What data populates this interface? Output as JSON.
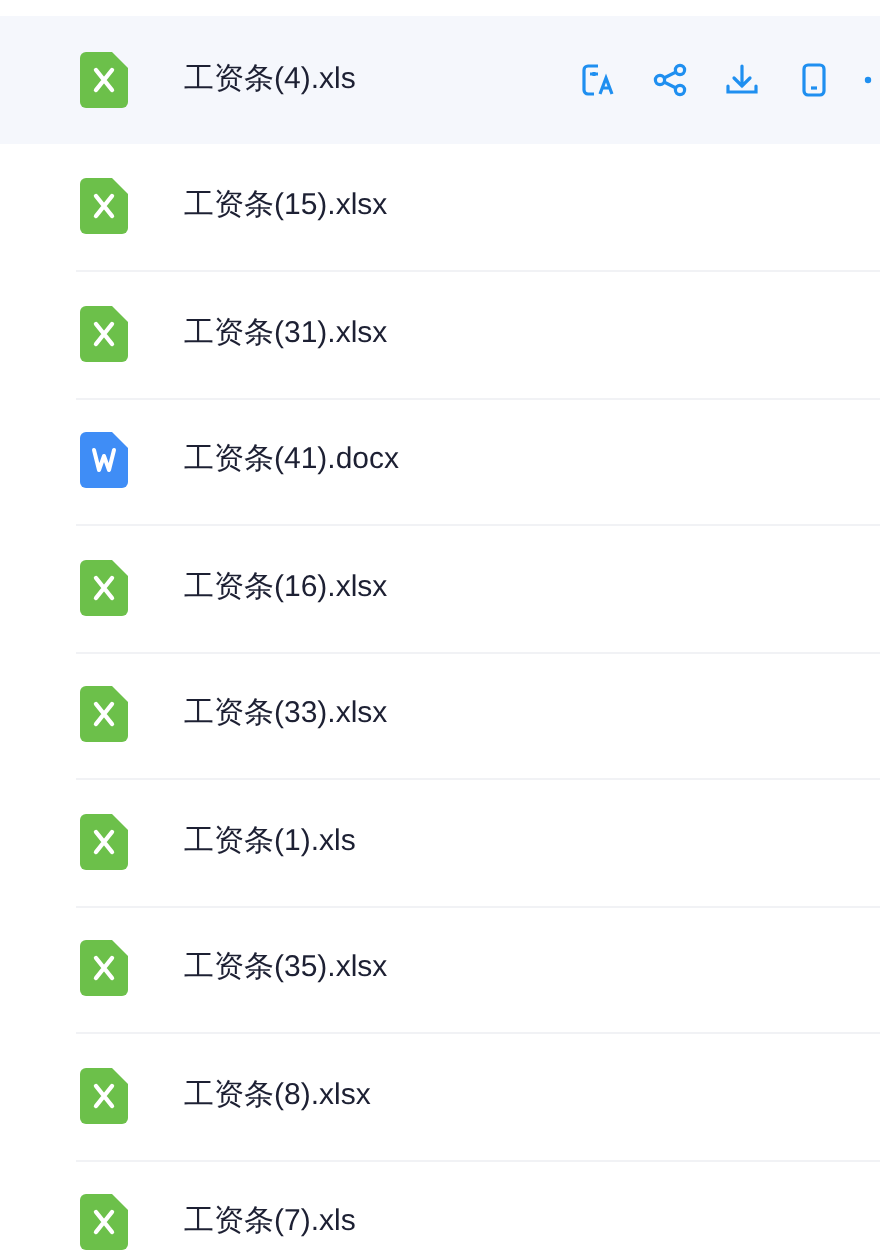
{
  "files": [
    {
      "name": "工资条(4).xls",
      "kind": "xls",
      "hovered": true
    },
    {
      "name": "工资条(15).xlsx",
      "kind": "xls",
      "hovered": false
    },
    {
      "name": "工资条(31).xlsx",
      "kind": "xls",
      "hovered": false
    },
    {
      "name": "工资条(41).docx",
      "kind": "doc",
      "hovered": false
    },
    {
      "name": "工资条(16).xlsx",
      "kind": "xls",
      "hovered": false
    },
    {
      "name": "工资条(33).xlsx",
      "kind": "xls",
      "hovered": false
    },
    {
      "name": "工资条(1).xls",
      "kind": "xls",
      "hovered": false
    },
    {
      "name": "工资条(35).xlsx",
      "kind": "xls",
      "hovered": false
    },
    {
      "name": "工资条(8).xlsx",
      "kind": "xls",
      "hovered": false
    },
    {
      "name": "工资条(7).xls",
      "kind": "xls",
      "hovered": false
    }
  ]
}
